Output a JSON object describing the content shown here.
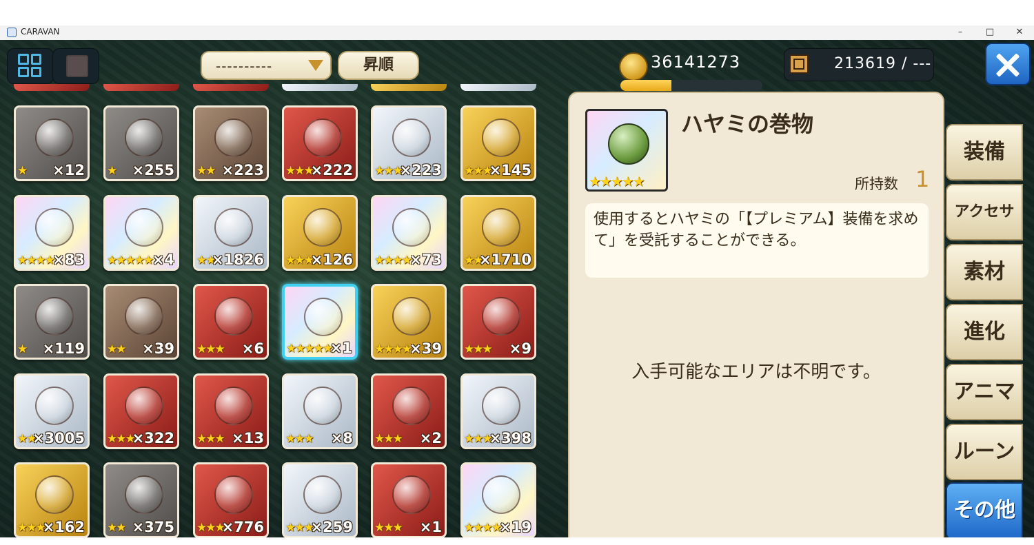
{
  "window": {
    "title": "CARAVAN",
    "minimize": "–",
    "maximize": "□",
    "close": "✕"
  },
  "toolbar": {
    "filter_value": "----------",
    "sort_label": "昇順"
  },
  "currency": {
    "gold": "36141273",
    "gold_bar_fraction": 0.36,
    "capacity": "213619 / ---"
  },
  "items": [
    {
      "stars": "★",
      "count": "×12",
      "bg": "gray"
    },
    {
      "stars": "★",
      "count": "×255",
      "bg": "gray"
    },
    {
      "stars": "★★",
      "count": "×223",
      "bg": "brown"
    },
    {
      "stars": "★★★",
      "count": "×222",
      "bg": "red"
    },
    {
      "stars": "★★★",
      "count": "×223",
      "bg": "silver"
    },
    {
      "stars": "★★★",
      "count": "×145",
      "bg": "gold"
    },
    {
      "stars": "★★★★",
      "count": "×83",
      "bg": "rainbow"
    },
    {
      "stars": "★★★★★",
      "count": "×4",
      "bg": "rainbow"
    },
    {
      "stars": "★★",
      "count": "×1826",
      "bg": "silver"
    },
    {
      "stars": "★★★",
      "count": "×126",
      "bg": "gold"
    },
    {
      "stars": "★★★★",
      "count": "×73",
      "bg": "rainbow"
    },
    {
      "stars": "★★",
      "count": "×1710",
      "bg": "gold"
    },
    {
      "stars": "★",
      "count": "×119",
      "bg": "gray"
    },
    {
      "stars": "★★",
      "count": "×39",
      "bg": "brown"
    },
    {
      "stars": "★★★",
      "count": "×6",
      "bg": "red"
    },
    {
      "stars": "★★★★★",
      "count": "×1",
      "bg": "rainbow",
      "selected": true
    },
    {
      "stars": "★★★★",
      "count": "×39",
      "bg": "gold"
    },
    {
      "stars": "★★★",
      "count": "×9",
      "bg": "red"
    },
    {
      "stars": "★★",
      "count": "×3005",
      "bg": "silver"
    },
    {
      "stars": "★★★",
      "count": "×322",
      "bg": "red"
    },
    {
      "stars": "★★★",
      "count": "×13",
      "bg": "red"
    },
    {
      "stars": "★★★",
      "count": "×8",
      "bg": "silver"
    },
    {
      "stars": "★★★",
      "count": "×2",
      "bg": "red"
    },
    {
      "stars": "★★★",
      "count": "×398",
      "bg": "silver"
    },
    {
      "stars": "★★★",
      "count": "×162",
      "bg": "gold"
    },
    {
      "stars": "★★",
      "count": "×375",
      "bg": "gray"
    },
    {
      "stars": "★★★",
      "count": "×776",
      "bg": "red"
    },
    {
      "stars": "★★★",
      "count": "×259",
      "bg": "silver"
    },
    {
      "stars": "★★★",
      "count": "×1",
      "bg": "red"
    },
    {
      "stars": "★★★★",
      "count": "×19",
      "bg": "rainbow"
    }
  ],
  "detail": {
    "name": "ハヤミの巻物",
    "stars": "★★★★★",
    "owned_label": "所持数",
    "owned_value": "1",
    "description": "使用するとハヤミの「【プレミアム】装備を求めて」を受託することができる。",
    "area_text": "入手可能なエリアは不明です。"
  },
  "tabs": [
    {
      "label": "装備",
      "active": false
    },
    {
      "label": "アクセサリ",
      "active": false
    },
    {
      "label": "素材",
      "active": false
    },
    {
      "label": "進化",
      "active": false
    },
    {
      "label": "アニマ",
      "active": false
    },
    {
      "label": "ルーン",
      "active": false
    },
    {
      "label": "その他",
      "active": true
    }
  ]
}
